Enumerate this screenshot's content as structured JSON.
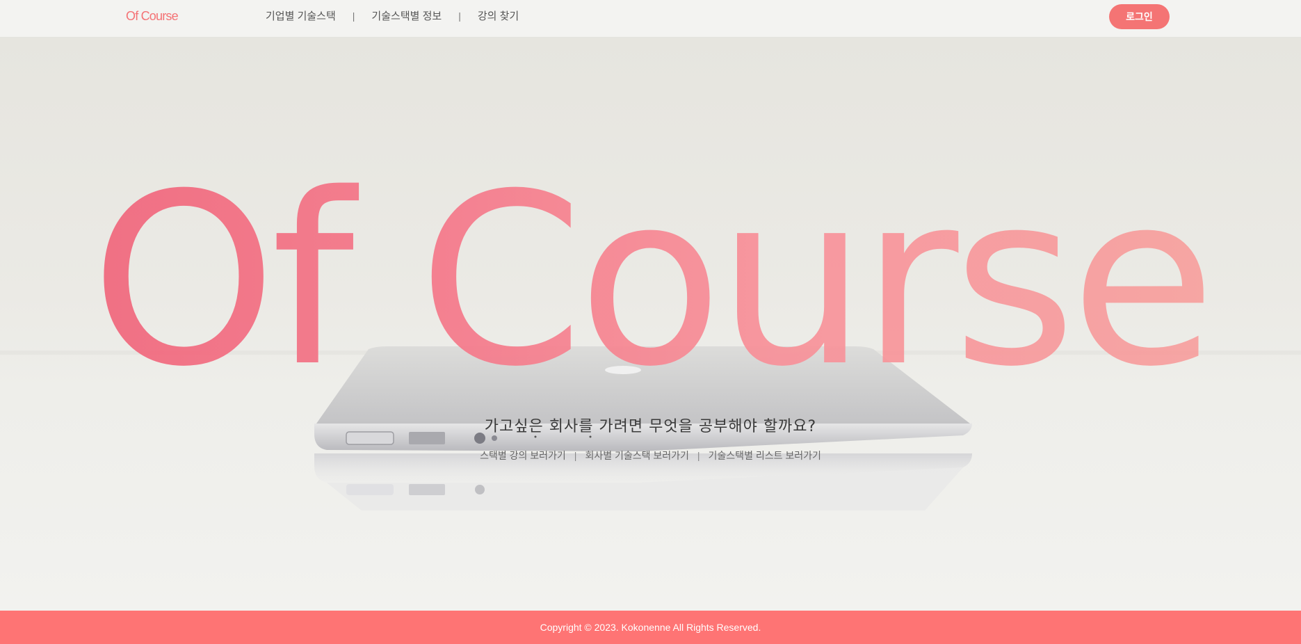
{
  "header": {
    "logo": "Of Course",
    "nav": [
      {
        "label": "기업별 기술스택"
      },
      {
        "label": "기술스택별 정보"
      },
      {
        "label": "강의 찾기"
      }
    ],
    "separator": "|",
    "login_label": "로그인"
  },
  "hero": {
    "wordmark": "Of Course",
    "question": "가고싶은 회사를 가려면 무엇을 공부해야 할까요?",
    "links": [
      {
        "label": "스택별 강의 보러가기"
      },
      {
        "label": "회사별 기술스택 보러가기"
      },
      {
        "label": "기술스택별 리스트 보러가기"
      }
    ],
    "separator": "|"
  },
  "footer": {
    "copyright": "Copyright © 2023. Kokonenne All Rights Reserved."
  },
  "colors": {
    "accent": "#fe7474",
    "logo": "#f47275",
    "wordmark_start": "#f06279",
    "wordmark_end": "#f7a4a0"
  }
}
